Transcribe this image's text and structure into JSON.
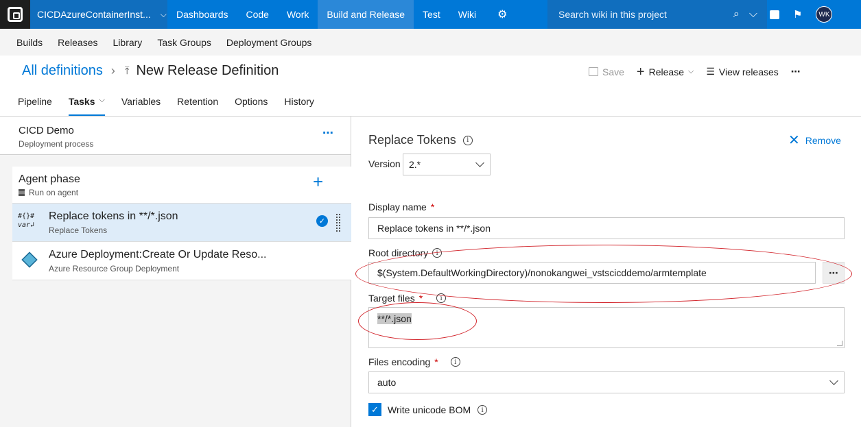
{
  "topnav": {
    "project": "CICDAzureContainerInst...",
    "items": [
      "Dashboards",
      "Code",
      "Work",
      "Build and Release",
      "Test",
      "Wiki"
    ],
    "search_placeholder": "Search wiki in this project",
    "avatar_initials": "WK"
  },
  "subnav": {
    "items": [
      "Builds",
      "Releases",
      "Library",
      "Task Groups",
      "Deployment Groups"
    ]
  },
  "header": {
    "all_definitions": "All definitions",
    "title": "New Release Definition",
    "save": "Save",
    "release": "Release",
    "view_releases": "View releases"
  },
  "tabs": [
    "Pipeline",
    "Tasks",
    "Variables",
    "Retention",
    "Options",
    "History"
  ],
  "left_panel": {
    "process_name": "CICD Demo",
    "process_sub": "Deployment process",
    "phase_name": "Agent phase",
    "phase_sub": "Run on agent",
    "tasks": [
      {
        "icon_top": "#{}#",
        "icon_bottom": "var",
        "name": "Replace tokens in **/*.json",
        "sub": "Replace Tokens"
      },
      {
        "name": "Azure Deployment:Create Or Update Reso...",
        "sub": "Azure Resource Group Deployment"
      }
    ]
  },
  "right_panel": {
    "title": "Replace Tokens",
    "remove": "Remove",
    "version_label": "Version",
    "version_value": "2.*",
    "display_name_label": "Display name",
    "display_name_value": "Replace tokens in **/*.json",
    "root_dir_label": "Root directory",
    "root_dir_value": "$(System.DefaultWorkingDirectory)/nonokangwei_vstscicddemo/armtemplate",
    "target_files_label": "Target files",
    "target_files_value": "**/*.json",
    "encoding_label": "Files encoding",
    "encoding_value": "auto",
    "bom_label": "Write unicode BOM",
    "required_mark": "*",
    "info_glyph": "i"
  },
  "colors": {
    "brand": "#0078d7",
    "annotation": "#d2232a"
  }
}
